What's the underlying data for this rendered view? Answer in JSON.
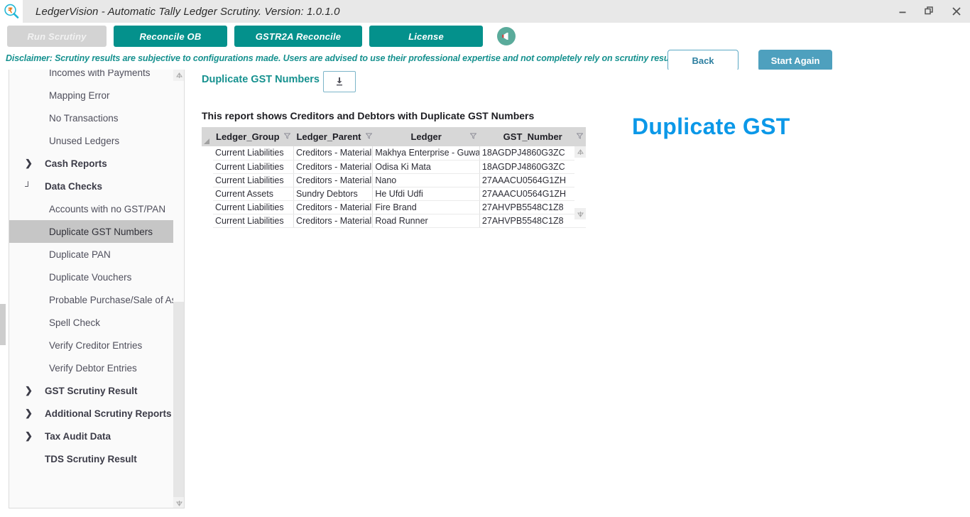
{
  "window": {
    "title": "LedgerVision - Automatic Tally Ledger Scrutiny.  Version: 1.0.1.0",
    "app_icon": "rupee-magnifier-icon",
    "minimize": "minimize-icon",
    "maximize": "restore-icon",
    "close": "close-icon"
  },
  "tabs": [
    {
      "label": "Run Scrutiny",
      "active": false
    },
    {
      "label": "Reconcile OB",
      "active": true
    },
    {
      "label": "GSTR2A Reconcile",
      "active": true
    },
    {
      "label": "License",
      "active": true
    }
  ],
  "announcement_icon": "megaphone-icon",
  "disclaimer": "Disclaimer: Scrutiny results are subjective to configurations made. Users are advised to use their professional expertise and not completely rely on scrutiny results.",
  "actions": {
    "back_label": "Back",
    "start_again_label": "Start Again"
  },
  "sidebar": {
    "items": [
      {
        "label": "Incomes with Payments",
        "type": "child",
        "selected": false
      },
      {
        "label": "Mapping Error",
        "type": "child",
        "selected": false
      },
      {
        "label": "No Transactions",
        "type": "child",
        "selected": false
      },
      {
        "label": "Unused Ledgers",
        "type": "child",
        "selected": false
      },
      {
        "label": "Cash Reports",
        "type": "group",
        "expanded": false,
        "chevron": "❯",
        "selected": false
      },
      {
        "label": "Data Checks",
        "type": "group",
        "expanded": true,
        "chevron": "┘",
        "selected": false
      },
      {
        "label": "Accounts with no GST/PAN",
        "type": "child",
        "selected": false
      },
      {
        "label": "Duplicate GST Numbers",
        "type": "child",
        "selected": true
      },
      {
        "label": "Duplicate PAN",
        "type": "child",
        "selected": false
      },
      {
        "label": "Duplicate Vouchers",
        "type": "child",
        "selected": false
      },
      {
        "label": "Probable Purchase/Sale of Assets",
        "type": "child",
        "selected": false
      },
      {
        "label": "Spell Check",
        "type": "child",
        "selected": false
      },
      {
        "label": "Verify Creditor Entries",
        "type": "child",
        "selected": false
      },
      {
        "label": "Verify Debtor Entries",
        "type": "child",
        "selected": false
      },
      {
        "label": "GST Scrutiny Result",
        "type": "group",
        "expanded": false,
        "chevron": "❯",
        "selected": false
      },
      {
        "label": "Additional Scrutiny Reports",
        "type": "group",
        "expanded": false,
        "chevron": "❯",
        "selected": false
      },
      {
        "label": "Tax Audit Data",
        "type": "group",
        "expanded": false,
        "chevron": "❯",
        "selected": false
      },
      {
        "label": "TDS Scrutiny Result",
        "type": "group",
        "expanded": false,
        "chevron": "",
        "selected": false
      }
    ],
    "scrollbar": {
      "up_icon": "scroll-up-icon",
      "down_icon": "scroll-down-icon"
    }
  },
  "main": {
    "report_title": "Duplicate GST Numbers",
    "download_icon": "download-icon",
    "report_description": "This report shows Creditors and Debtors with Duplicate GST Numbers",
    "watermark": "Duplicate GST",
    "table": {
      "columns": [
        {
          "label": "Ledger_Group",
          "filter_icon": "filter-funnel-icon",
          "align": "left"
        },
        {
          "label": "Ledger_Parent",
          "filter_icon": "filter-funnel-icon",
          "align": "left"
        },
        {
          "label": "Ledger",
          "filter_icon": "filter-funnel-icon",
          "align": "center"
        },
        {
          "label": "GST_Number",
          "filter_icon": "filter-funnel-icon",
          "align": "center"
        }
      ],
      "rows": [
        [
          "Current Liabilities",
          "Creditors - Material",
          "Makhya Enterprise - Guwahati",
          "18AGDPJ4860G3ZC"
        ],
        [
          "Current Liabilities",
          "Creditors - Material",
          "Odisa Ki Mata",
          "18AGDPJ4860G3ZC"
        ],
        [
          "Current Liabilities",
          "Creditors - Material",
          "Nano",
          "27AAACU0564G1ZH"
        ],
        [
          "Current Assets",
          "Sundry Debtors",
          "He Ufdi Udfi",
          "27AAACU0564G1ZH"
        ],
        [
          "Current Liabilities",
          "Creditors - Material",
          "Fire Brand",
          "27AHVPB5548C1Z8"
        ],
        [
          "Current Liabilities",
          "Creditors - Material",
          "Road Runner",
          "27AHVPB5548C1Z8"
        ]
      ],
      "scrollbar": {
        "up_icon": "scroll-up-icon",
        "down_icon": "scroll-down-icon"
      }
    }
  },
  "colors": {
    "teal": "#04918c",
    "accent_blue": "#0b98e8",
    "button_blue": "#4ea0be",
    "selected_row": "#c6c6c6"
  }
}
